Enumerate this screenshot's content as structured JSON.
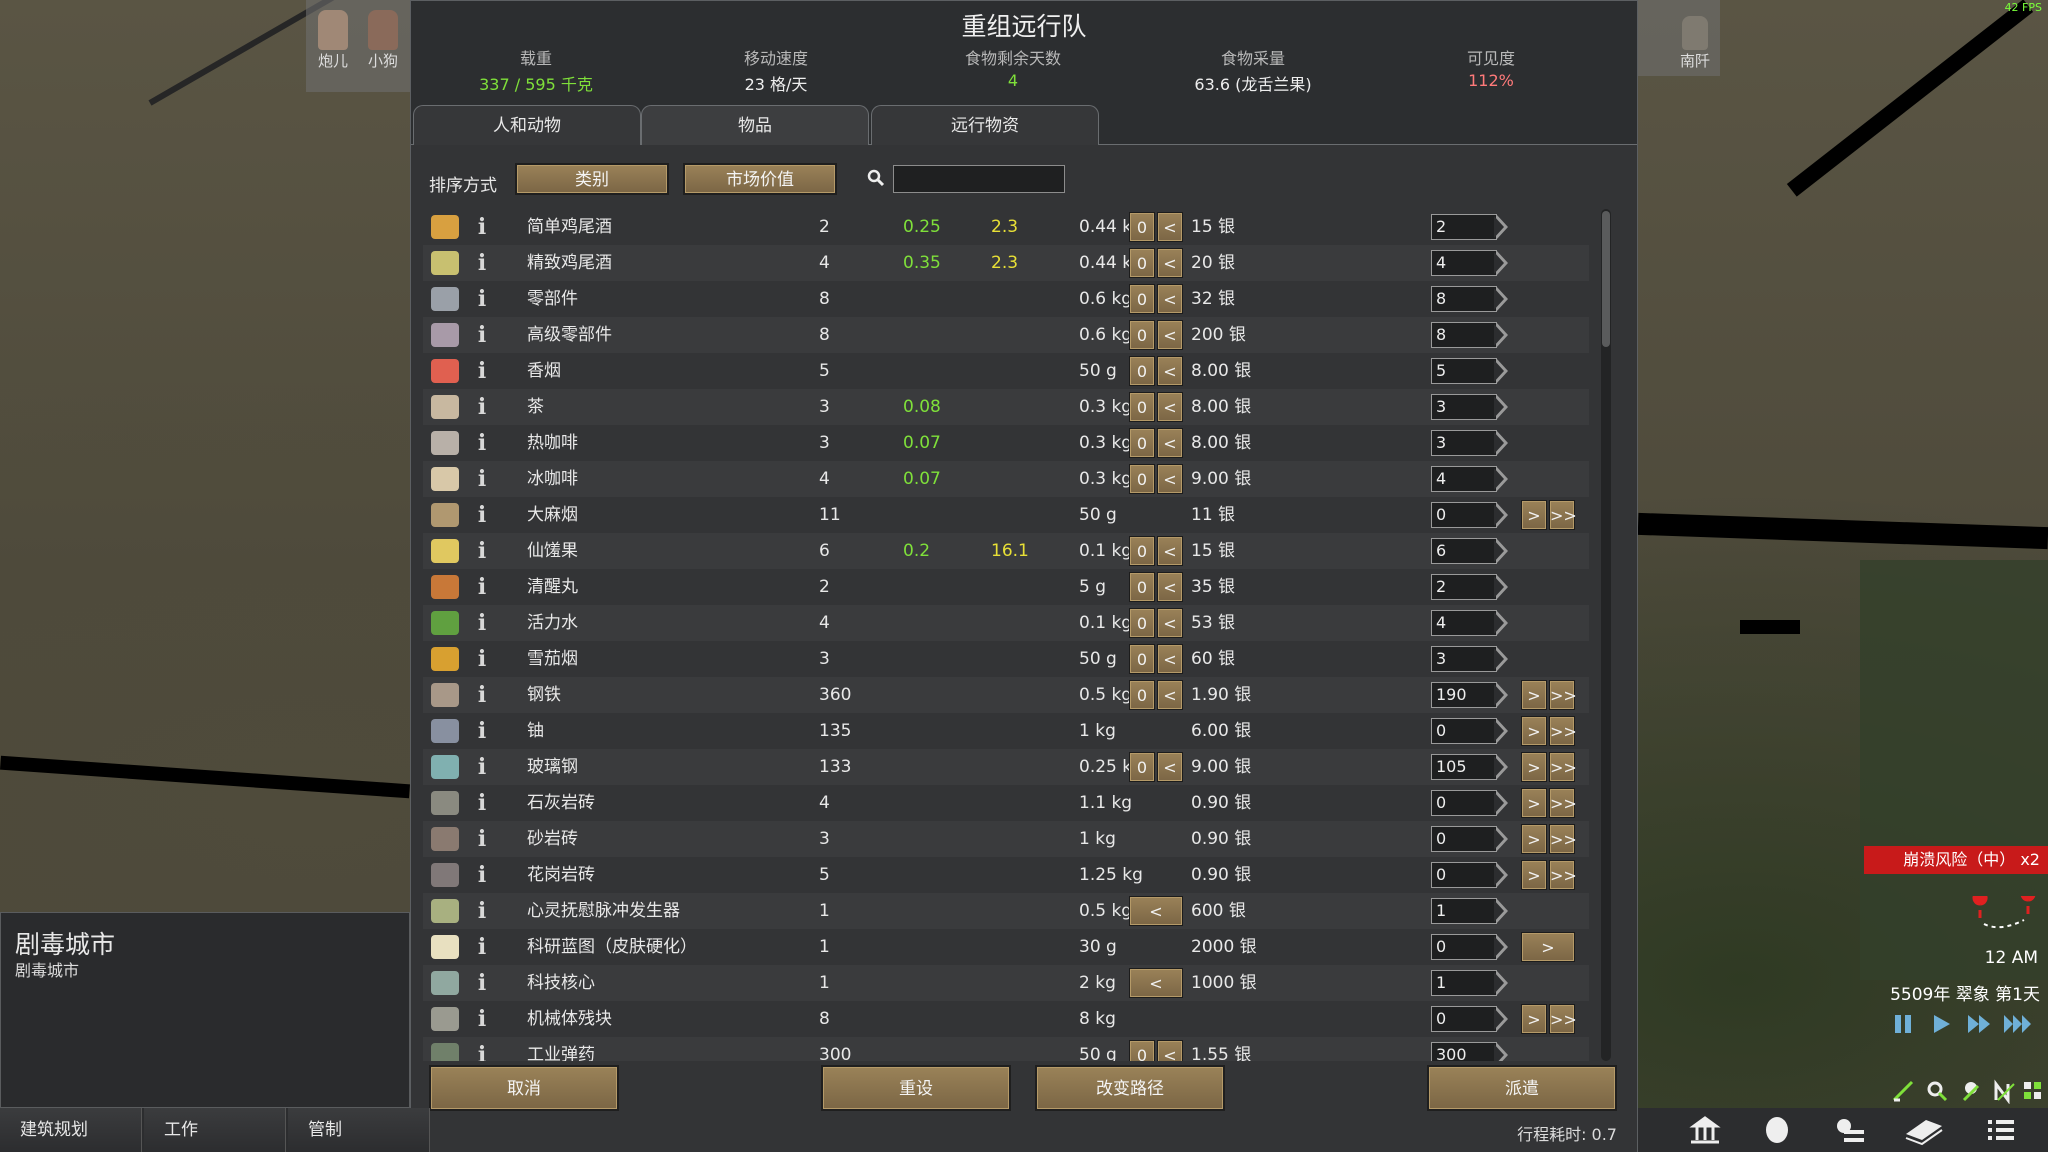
{
  "fps": "42 FPS",
  "top_portraits": [
    "炮儿",
    "小狗"
  ],
  "top_right_portraits": [
    "",
    "南阡"
  ],
  "dialog": {
    "title": "重组远行队",
    "stats": [
      {
        "label": "载重",
        "value": "337 / 595 千克",
        "color": "#7fe03a"
      },
      {
        "label": "移动速度",
        "value": "23 格/天",
        "color": "#eeeeee"
      },
      {
        "label": "食物剩余天数",
        "value": "4",
        "color": "#7fe03a"
      },
      {
        "label": "食物采量",
        "value": "63.6 (龙舌兰果)",
        "color": "#eeeeee"
      },
      {
        "label": "可见度",
        "value": "112%",
        "color": "#ff7a7a"
      }
    ],
    "tabs": [
      "人和动物",
      "物品",
      "远行物资"
    ],
    "active_tab": 1,
    "sort_label": "排序方式",
    "sort_buttons": [
      "类别",
      "市场价值"
    ],
    "search_placeholder": "",
    "bottom_buttons": [
      "取消",
      "重设",
      "改变路径",
      "派遣"
    ],
    "travel_time": "行程耗时:  0.7"
  },
  "items": [
    {
      "name": "简单鸡尾酒",
      "count": "2",
      "nut": "0.25",
      "days": "2.3",
      "mass": "0.44 kg",
      "value": "15 银",
      "left": true,
      "qty": "2",
      "right": false,
      "icon": "#d8a040"
    },
    {
      "name": "精致鸡尾酒",
      "count": "4",
      "nut": "0.35",
      "days": "2.3",
      "mass": "0.44 kg",
      "value": "20 银",
      "left": true,
      "qty": "4",
      "right": false,
      "icon": "#c8c070"
    },
    {
      "name": "零部件",
      "count": "8",
      "nut": "",
      "days": "",
      "mass": "0.6 kg",
      "value": "32 银",
      "left": true,
      "qty": "8",
      "right": false,
      "icon": "#9aa0a8"
    },
    {
      "name": "高级零部件",
      "count": "8",
      "nut": "",
      "days": "",
      "mass": "0.6 kg",
      "value": "200 银",
      "left": true,
      "qty": "8",
      "right": false,
      "icon": "#a89aa8"
    },
    {
      "name": "香烟",
      "count": "5",
      "nut": "",
      "days": "",
      "mass": "50 g",
      "value": "8.00 银",
      "left": true,
      "qty": "5",
      "right": false,
      "icon": "#e06050"
    },
    {
      "name": "茶",
      "count": "3",
      "nut": "0.08",
      "days": "",
      "mass": "0.3 kg",
      "value": "8.00 银",
      "left": true,
      "qty": "3",
      "right": false,
      "icon": "#c8b8a0"
    },
    {
      "name": "热咖啡",
      "count": "3",
      "nut": "0.07",
      "days": "",
      "mass": "0.3 kg",
      "value": "8.00 银",
      "left": true,
      "qty": "3",
      "right": false,
      "icon": "#b8b0a8"
    },
    {
      "name": "冰咖啡",
      "count": "4",
      "nut": "0.07",
      "days": "",
      "mass": "0.3 kg",
      "value": "9.00 银",
      "left": true,
      "qty": "4",
      "right": false,
      "icon": "#d8c8a8"
    },
    {
      "name": "大麻烟",
      "count": "11",
      "nut": "",
      "days": "",
      "mass": "50 g",
      "value": "11 银",
      "left": false,
      "qty": "0",
      "right": true,
      "icon": "#b09870"
    },
    {
      "name": "仙馐果",
      "count": "6",
      "nut": "0.2",
      "days": "16.1",
      "mass": "0.1 kg",
      "value": "15 银",
      "left": true,
      "qty": "6",
      "right": false,
      "icon": "#e0c860"
    },
    {
      "name": "清醒丸",
      "count": "2",
      "nut": "",
      "days": "",
      "mass": "5 g",
      "value": "35 银",
      "left": true,
      "qty": "2",
      "right": false,
      "icon": "#c87838"
    },
    {
      "name": "活力水",
      "count": "4",
      "nut": "",
      "days": "",
      "mass": "0.1 kg",
      "value": "53 银",
      "left": true,
      "qty": "4",
      "right": false,
      "icon": "#60a040"
    },
    {
      "name": "雪茄烟",
      "count": "3",
      "nut": "",
      "days": "",
      "mass": "50 g",
      "value": "60 银",
      "left": true,
      "qty": "3",
      "right": false,
      "icon": "#d8a030"
    },
    {
      "name": "钢铁",
      "count": "360",
      "nut": "",
      "days": "",
      "mass": "0.5 kg",
      "value": "1.90 银",
      "left": true,
      "qty": "190",
      "right": true,
      "icon": "#a89888"
    },
    {
      "name": "铀",
      "count": "135",
      "nut": "",
      "days": "",
      "mass": "1 kg",
      "value": "6.00 银",
      "left": false,
      "qty": "0",
      "right": true,
      "icon": "#8890a0"
    },
    {
      "name": "玻璃钢",
      "count": "133",
      "nut": "",
      "days": "",
      "mass": "0.25 kg",
      "value": "9.00 银",
      "left": true,
      "qty": "105",
      "right": true,
      "icon": "#80b0b0"
    },
    {
      "name": "石灰岩砖",
      "count": "4",
      "nut": "",
      "days": "",
      "mass": "1.1 kg",
      "value": "0.90 银",
      "left": false,
      "qty": "0",
      "right": true,
      "icon": "#8a8a80"
    },
    {
      "name": "砂岩砖",
      "count": "3",
      "nut": "",
      "days": "",
      "mass": "1 kg",
      "value": "0.90 银",
      "left": false,
      "qty": "0",
      "right": true,
      "icon": "#8a7a70"
    },
    {
      "name": "花岗岩砖",
      "count": "5",
      "nut": "",
      "days": "",
      "mass": "1.25 kg",
      "value": "0.90 银",
      "left": false,
      "qty": "0",
      "right": true,
      "icon": "#807878"
    },
    {
      "name": "心灵抚慰脉冲发生器",
      "count": "1",
      "nut": "",
      "days": "",
      "mass": "0.5 kg",
      "value": "600 银",
      "left": "single",
      "qty": "1",
      "right": false,
      "icon": "#a8b080"
    },
    {
      "name": "科研蓝图（皮肤硬化）",
      "count": "1",
      "nut": "",
      "days": "",
      "mass": "30 g",
      "value": "2000 银",
      "left": false,
      "qty": "0",
      "right": "single",
      "icon": "#e8e0c0"
    },
    {
      "name": "科技核心",
      "count": "1",
      "nut": "",
      "days": "",
      "mass": "2 kg",
      "value": "1000 银",
      "left": "single",
      "qty": "1",
      "right": false,
      "icon": "#90a8a0"
    },
    {
      "name": "机械体残块",
      "count": "8",
      "nut": "",
      "days": "",
      "mass": "8 kg",
      "value": "",
      "left": false,
      "qty": "0",
      "right": true,
      "icon": "#9a9a90"
    },
    {
      "name": "工业弹药",
      "count": "300",
      "nut": "",
      "days": "",
      "mass": "50 g",
      "value": "1.55 银",
      "left": true,
      "qty": "300",
      "right": false,
      "icon": "#70806a"
    }
  ],
  "buttons": {
    "zero": "0",
    "less": "<",
    "more": ">",
    "max": ">>"
  },
  "place": {
    "title": "剧毒城市",
    "subtitle": "剧毒城市"
  },
  "bottom_tabs": [
    "建筑规划",
    "工作",
    "管制"
  ],
  "alert": "崩溃风险（中） x2",
  "time": "12 AM",
  "date": "5509年 翠象 第1天"
}
